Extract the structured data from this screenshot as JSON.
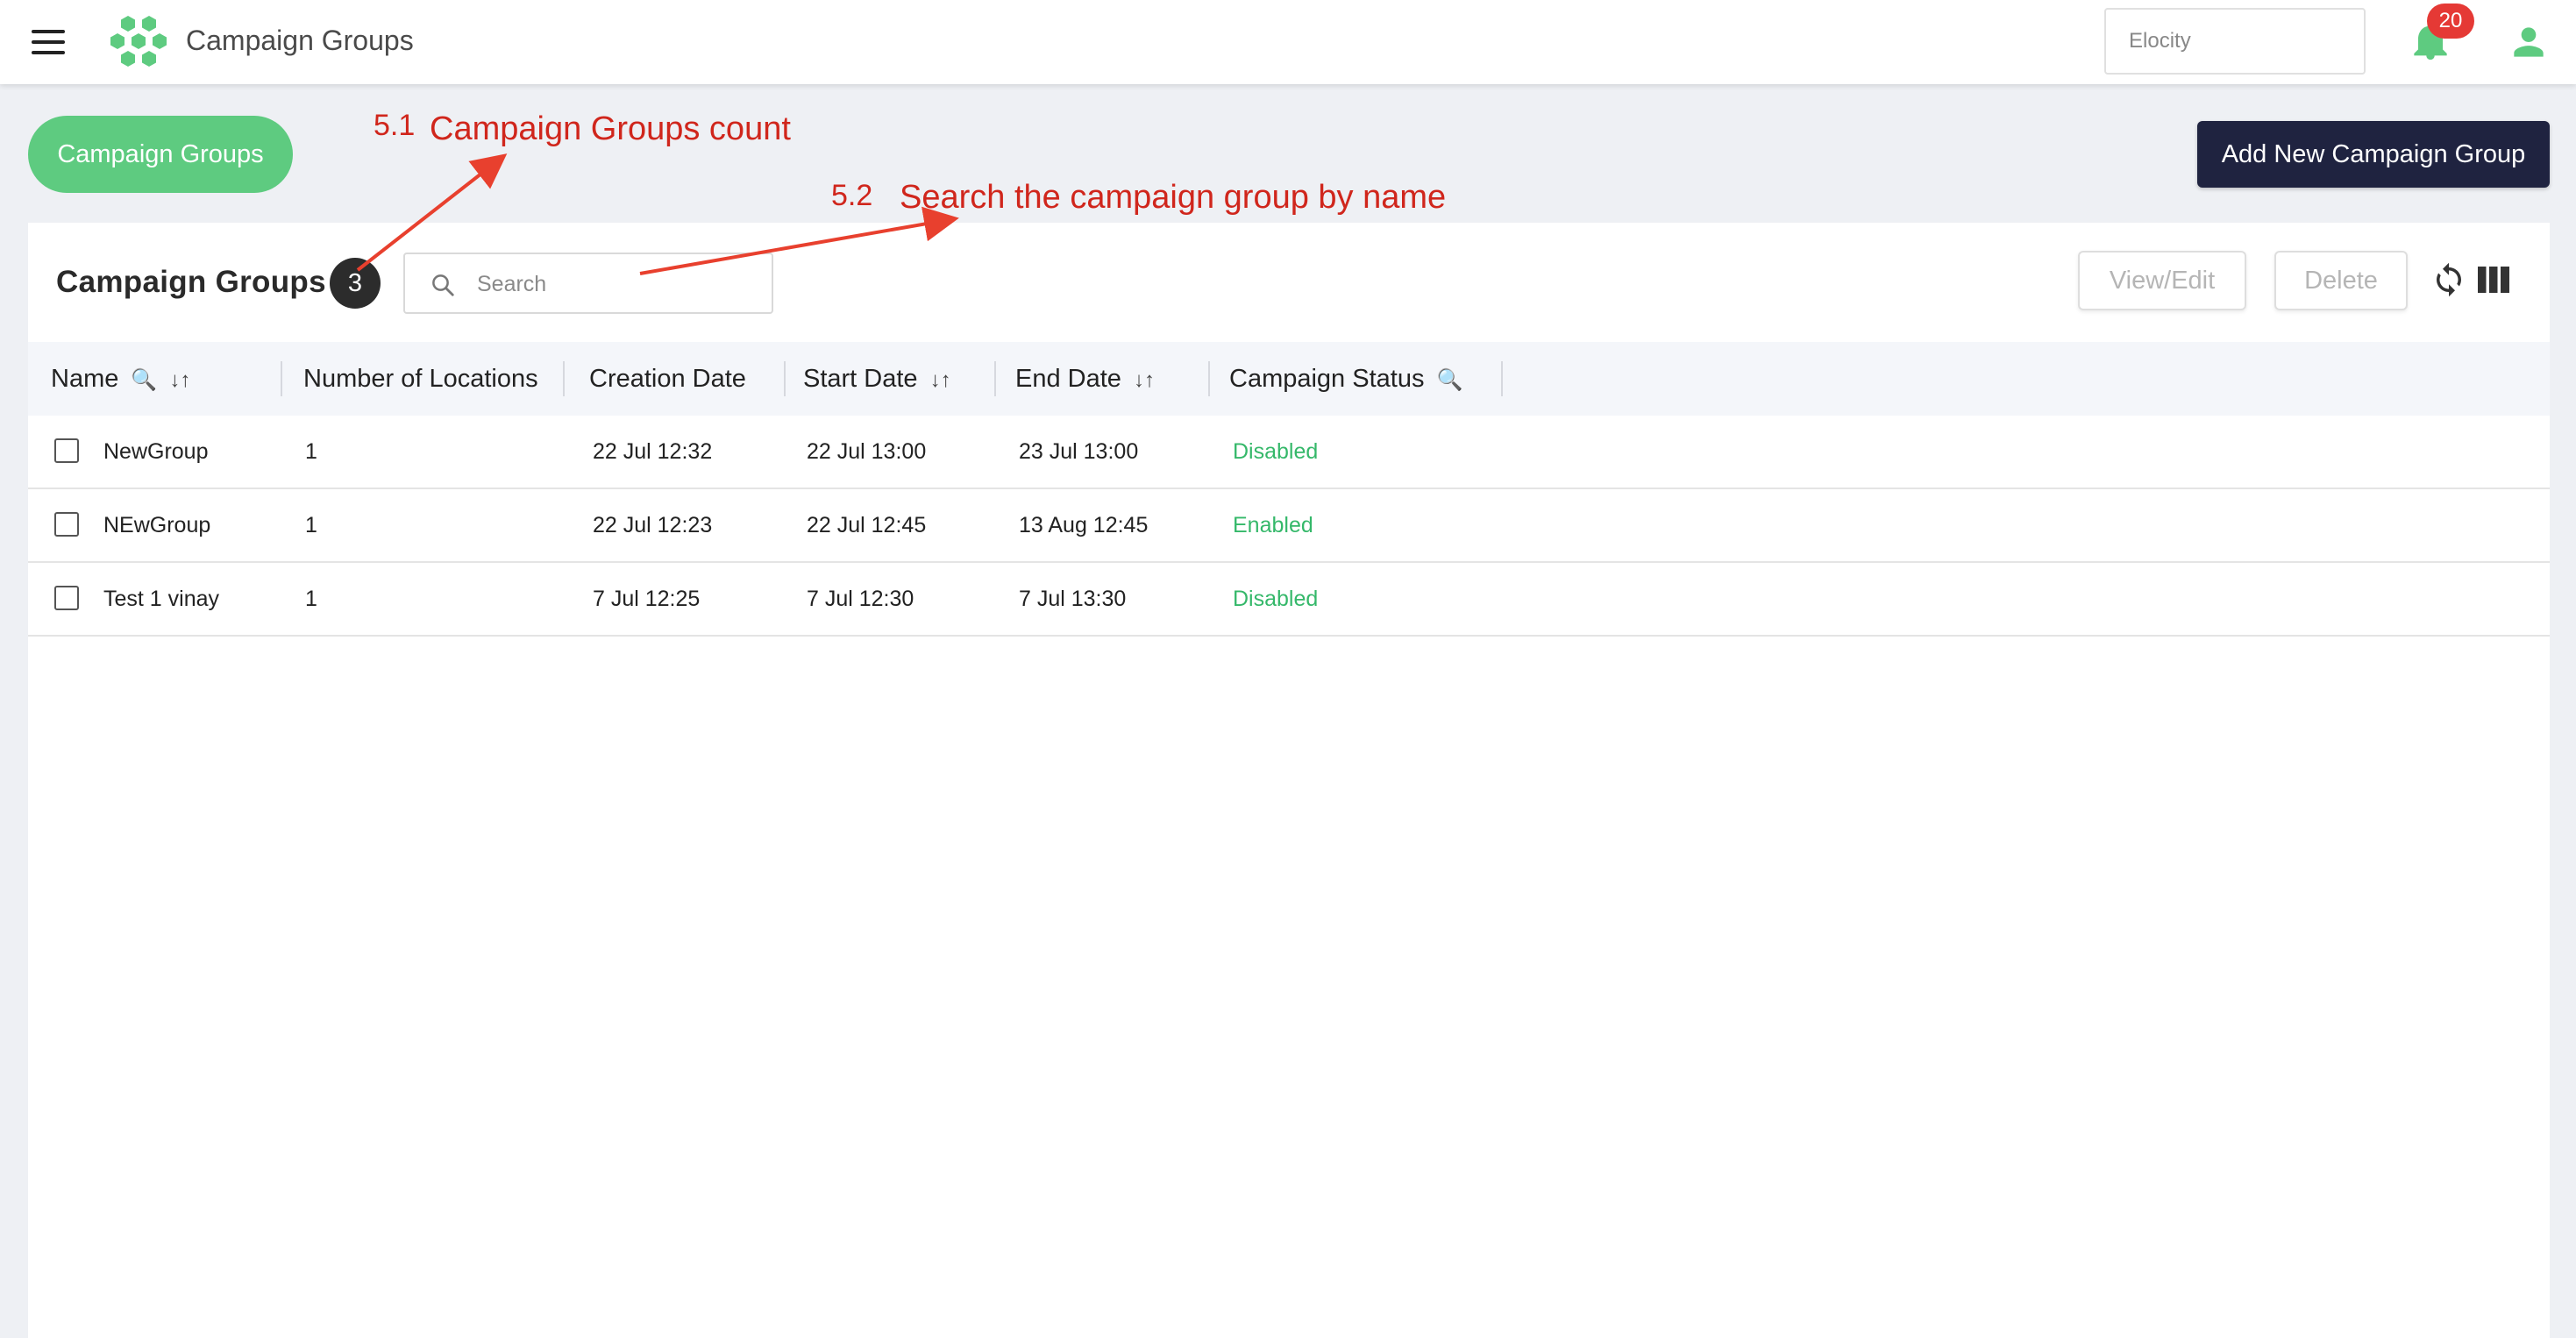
{
  "header": {
    "title": "Campaign Groups",
    "org_select_value": "Elocity",
    "notification_count": "20"
  },
  "subheader": {
    "pill_label": "Campaign Groups",
    "add_button_label": "Add New Campaign Group"
  },
  "card": {
    "title": "Campaign Groups",
    "count": "3",
    "search_placeholder": "Search",
    "view_edit_label": "View/Edit",
    "delete_label": "Delete"
  },
  "table": {
    "columns": [
      "Name",
      "Number of Locations",
      "Creation Date",
      "Start Date",
      "End Date",
      "Campaign Status"
    ],
    "rows": [
      {
        "name": "NewGroup",
        "locations": "1",
        "created": "22 Jul 12:32",
        "start": "22 Jul 13:00",
        "end": "23 Jul 13:00",
        "status": "Disabled"
      },
      {
        "name": "NEwGroup",
        "locations": "1",
        "created": "22 Jul 12:23",
        "start": "22 Jul 12:45",
        "end": "13 Aug 12:45",
        "status": "Enabled"
      },
      {
        "name": "Test 1 vinay",
        "locations": "1",
        "created": "7 Jul 12:25",
        "start": "7 Jul 12:30",
        "end": "7 Jul 13:30",
        "status": "Disabled"
      }
    ]
  },
  "annotations": {
    "a1_number": "5.1",
    "a1_text": "Campaign Groups count",
    "a2_number": "5.2",
    "a2_text": "Search the campaign group by name"
  },
  "colors": {
    "accent_green": "#5ecb80",
    "status_green": "#35b86a",
    "primary_dark": "#1f2340",
    "badge_red": "#e53935",
    "annotation_red": "#d0261c"
  },
  "icons": [
    "menu-icon",
    "hexagon-logo-icon",
    "bell-icon",
    "user-icon",
    "search-icon",
    "refresh-icon",
    "columns-icon",
    "sort-icon",
    "filter-search-icon"
  ]
}
